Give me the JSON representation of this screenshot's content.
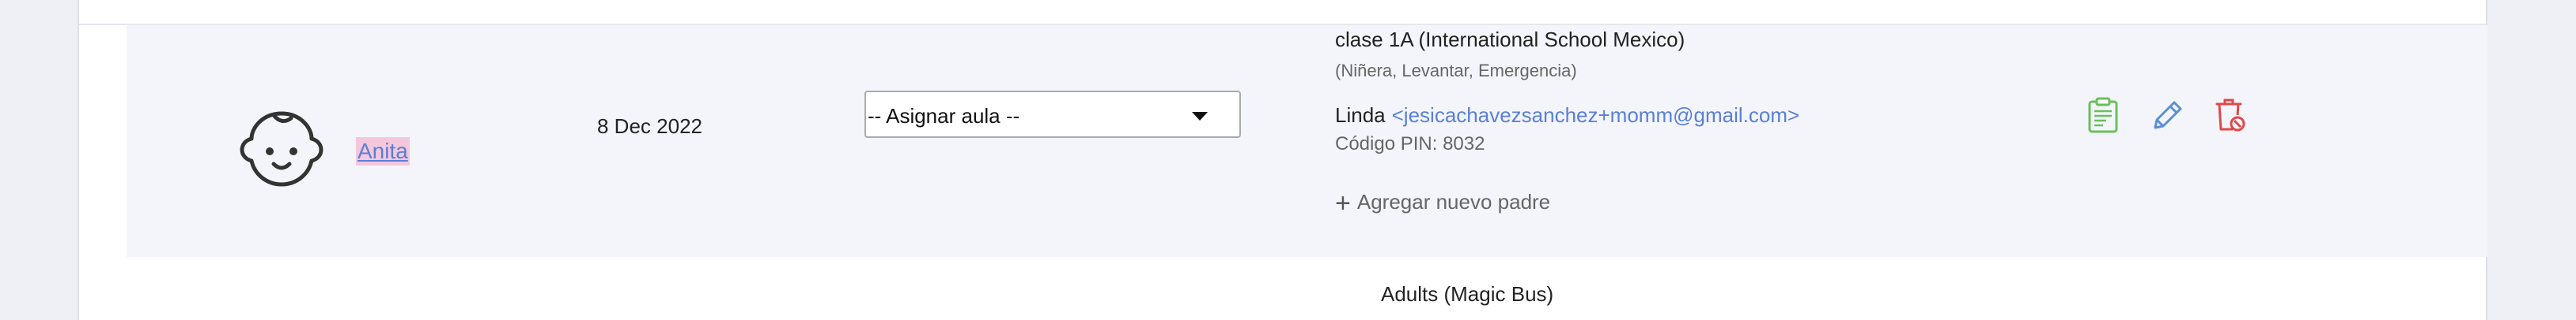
{
  "previous_row": {
    "faded_text": ""
  },
  "student": {
    "name": "Anita",
    "avatar_icon": "baby-face-icon",
    "date": "8 Dec 2022"
  },
  "classroom_select": {
    "selected": "-- Asignar aula --"
  },
  "classes": {
    "name": "clase 1A (International School Mexico)",
    "tags": "(Niñera, Levantar, Emergencia)"
  },
  "parent": {
    "name": "Linda",
    "email": "<jesicachavezsanchez+momm@gmail.com>",
    "pin": "Código PIN: 8032",
    "add_label": "Agregar nuevo padre",
    "add_icon": "+"
  },
  "actions": {
    "report_icon": "clipboard-report-icon",
    "edit_icon": "pencil-edit-icon",
    "delete_icon": "trash-delete-icon",
    "colors": {
      "report": "#6bbf59",
      "edit": "#5a8fd6",
      "delete": "#e04848"
    }
  },
  "next_row": {
    "class_name": "Adults (Magic Bus)"
  }
}
